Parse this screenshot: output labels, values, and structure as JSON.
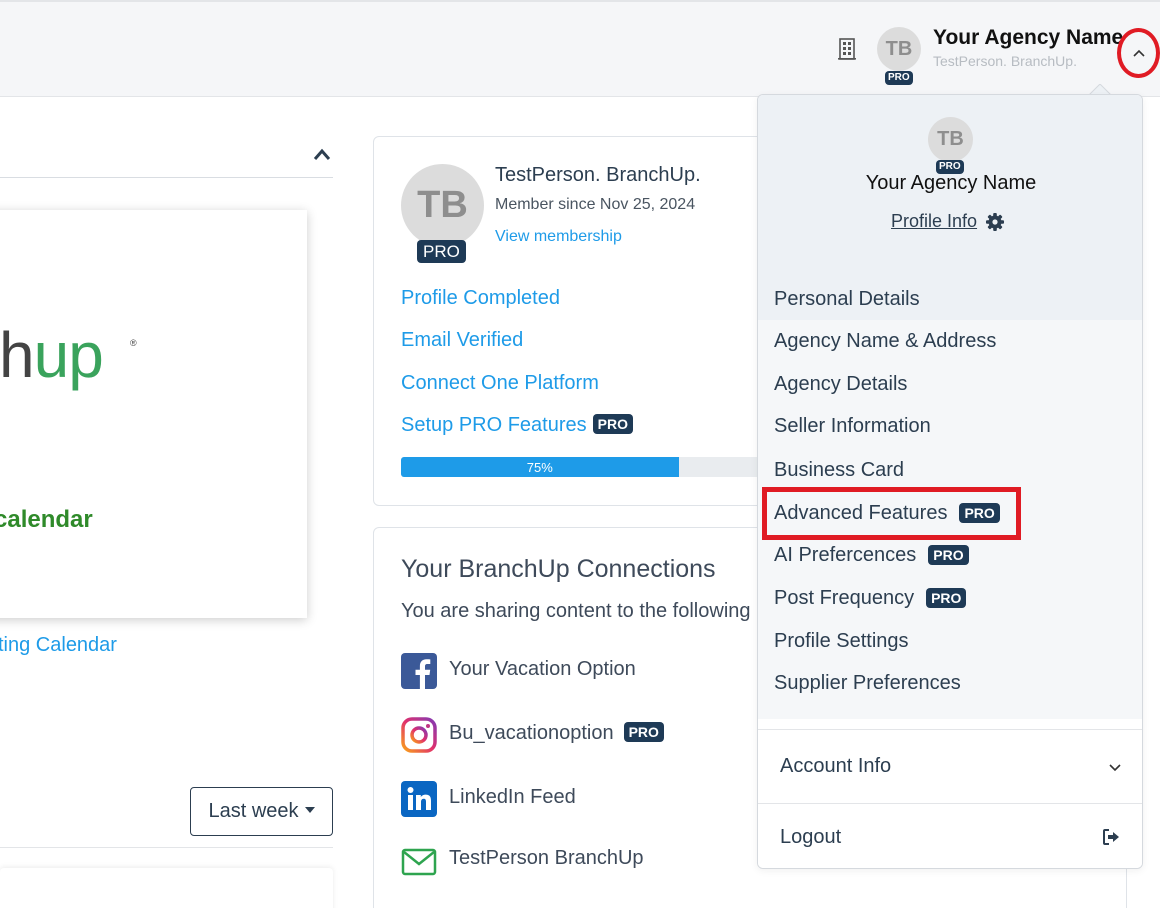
{
  "header": {
    "avatar_initials": "TB",
    "avatar_badge": "PRO",
    "agency_name": "Your Agency Name",
    "person_name": "TestPerson. BranchUp."
  },
  "left_panel": {
    "logo_part1": "ch",
    "logo_part2": "up",
    "logo_reg": "®",
    "calendar_text": "calendar",
    "calendar_link": "ting Calendar",
    "period_select": "Last week"
  },
  "profile_card": {
    "avatar_initials": "TB",
    "avatar_badge": "PRO",
    "name": "TestPerson. BranchUp.",
    "member_since": "Member since Nov 25, 2024",
    "view_membership": "View membership",
    "steps": [
      {
        "label": "Profile Completed"
      },
      {
        "label": "Email Verified"
      },
      {
        "label": "Connect One Platform"
      },
      {
        "label": "Setup PRO Features",
        "badge": "PRO"
      }
    ],
    "progress_label": "75%",
    "progress_value": 0.75
  },
  "connections": {
    "title": "Your BranchUp Connections",
    "subtitle": "You are sharing content to the following",
    "items": [
      {
        "icon": "facebook-icon",
        "label": "Your Vacation Option"
      },
      {
        "icon": "instagram-icon",
        "label": "Bu_vacationoption",
        "badge": "PRO"
      },
      {
        "icon": "linkedin-icon",
        "label": "LinkedIn Feed"
      },
      {
        "icon": "email-icon",
        "label": "TestPerson BranchUp"
      }
    ]
  },
  "dropdown": {
    "avatar_initials": "TB",
    "avatar_badge": "PRO",
    "agency_name": "Your Agency Name",
    "profile_info": "Profile Info",
    "menu": [
      {
        "label": "Personal Details"
      },
      {
        "label": "Agency Name & Address"
      },
      {
        "label": "Agency Details"
      },
      {
        "label": "Seller Information"
      },
      {
        "label": "Business Card"
      },
      {
        "label": "Advanced Features",
        "badge": "PRO"
      },
      {
        "label": "AI Prefercences",
        "badge": "PRO"
      },
      {
        "label": "Post Frequency",
        "badge": "PRO"
      },
      {
        "label": "Profile Settings"
      },
      {
        "label": "Supplier Preferences"
      }
    ],
    "account_info": "Account Info",
    "logout": "Logout"
  },
  "colors": {
    "accent": "#1e9be8",
    "pro_badge": "#1e3a56",
    "highlight": "#e01b24",
    "logo_green": "#3aa35c"
  }
}
